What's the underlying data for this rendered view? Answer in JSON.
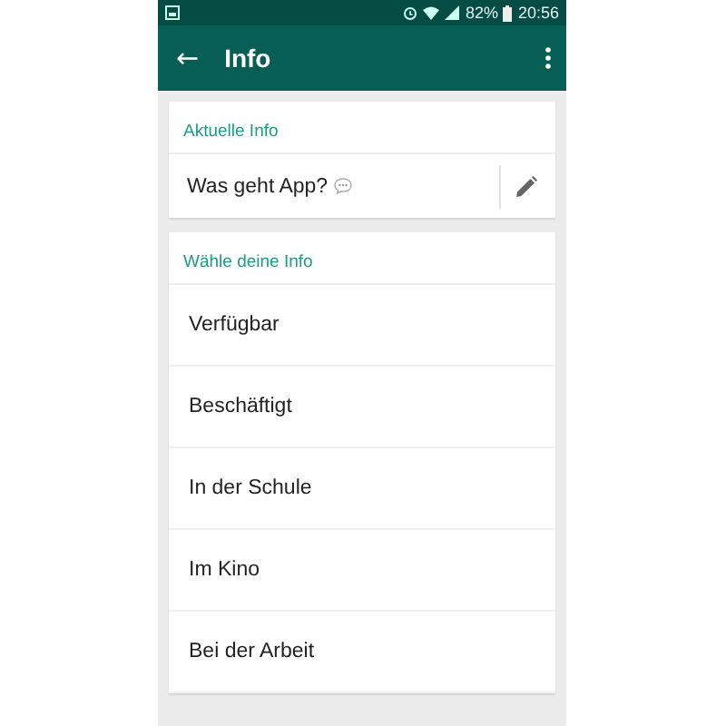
{
  "status_bar": {
    "battery": "82%",
    "time": "20:56"
  },
  "app_bar": {
    "back": "←",
    "title": "Info"
  },
  "current": {
    "header": "Aktuelle Info",
    "text": "Was geht App?"
  },
  "choices": {
    "header": "Wähle deine Info",
    "items": [
      "Verfügbar",
      "Beschäftigt",
      "In der Schule",
      "Im Kino",
      "Bei der Arbeit"
    ]
  }
}
